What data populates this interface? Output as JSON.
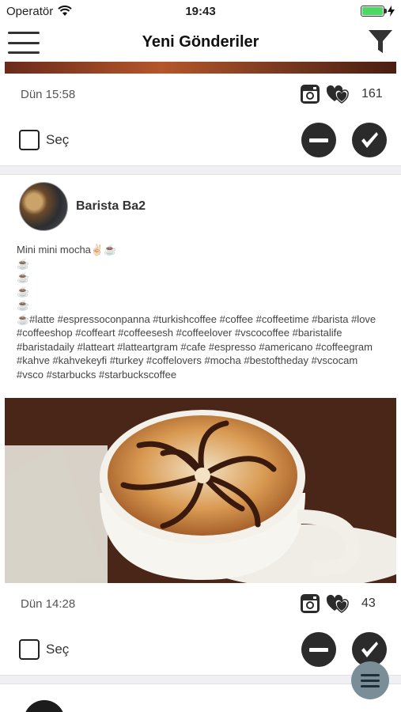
{
  "status_bar": {
    "carrier": "Operatör",
    "time": "19:43",
    "battery_level": 1.0,
    "battery_color": "#4cd964"
  },
  "navbar": {
    "title": "Yeni Gönderiler",
    "menu_icon": "hamburger-icon",
    "filter_icon": "filter-icon"
  },
  "posts": [
    {
      "date": "Dün 15:58",
      "likes": "161",
      "select_label": "Seç"
    },
    {
      "author": "Barista Ba2",
      "caption": "Mini mini mocha✌🏻☕\n☕\n☕\n☕\n☕\n☕#latte #espressoconpanna #turkishcoffee #coffee #coffeetime #barista #love #coffeeshop #coffeart #coffeesesh #coffeelover #vscocoffee #baristalife #baristadaily #latteart #latteartgram #cafe #espresso #americano #coffeegram #kahve #kahvekeyfi #turkey #coffelovers #mocha #bestoftheday #vscocam #vsco #starbucks #starbuckscoffee",
      "date": "Dün 14:28",
      "likes": "43",
      "select_label": "Seç"
    }
  ],
  "fab_icon": "list-menu-icon"
}
